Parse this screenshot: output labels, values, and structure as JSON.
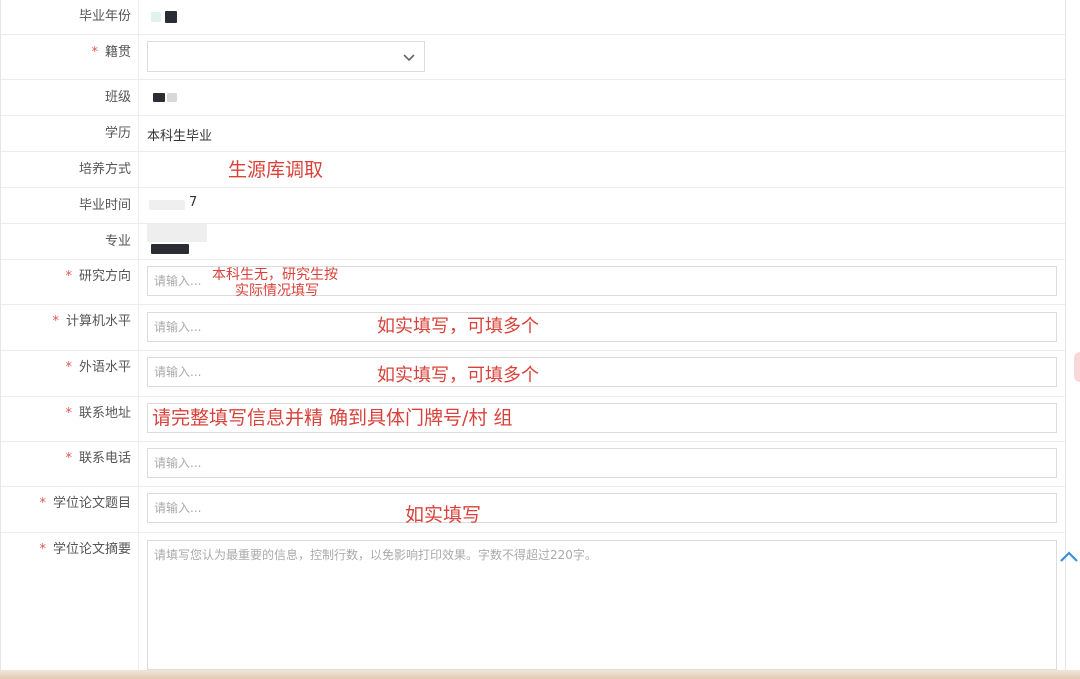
{
  "rows": [
    {
      "label": "毕业年份",
      "required": false,
      "kind": "value",
      "value": "",
      "redacted": true
    },
    {
      "label": "籍贯",
      "required": true,
      "kind": "select",
      "value": ""
    },
    {
      "label": "班级",
      "required": false,
      "kind": "value",
      "value": "",
      "redacted": true
    },
    {
      "label": "学历",
      "required": false,
      "kind": "value",
      "value": "本科生毕业"
    },
    {
      "label": "培养方式",
      "required": false,
      "kind": "value",
      "value": ""
    },
    {
      "label": "毕业时间",
      "required": false,
      "kind": "value",
      "value": "7",
      "redacted": true
    },
    {
      "label": "专业",
      "required": false,
      "kind": "value",
      "value": "",
      "redacted": true
    },
    {
      "label": "研究方向",
      "required": true,
      "kind": "input",
      "placeholder": "请输入..."
    },
    {
      "label": "计算机水平",
      "required": true,
      "kind": "input",
      "placeholder": "请输入..."
    },
    {
      "label": "外语水平",
      "required": true,
      "kind": "input",
      "placeholder": "请输入..."
    },
    {
      "label": "联系地址",
      "required": true,
      "kind": "input",
      "placeholder": ""
    },
    {
      "label": "联系电话",
      "required": true,
      "kind": "input",
      "placeholder": "请输入..."
    },
    {
      "label": "学位论文题目",
      "required": true,
      "kind": "input",
      "placeholder": "请输入..."
    },
    {
      "label": "学位论文摘要",
      "required": true,
      "kind": "textarea",
      "placeholder": "请填写您认为最重要的信息，控制行数，以免影响打印效果。字数不得超过220字。"
    }
  ],
  "required_mark": "*",
  "annotations": {
    "source_db": "生源库调取",
    "research_line1": "本科生无，研究生按",
    "research_line2": "实际情况填写",
    "computer": "如实填写，可填多个",
    "language": "如实填写，可填多个",
    "address": "请完整填写信息并精 确到具体门牌号/村 组",
    "thesis_title": "如实填写"
  },
  "colors": {
    "annotation": "#d9423a",
    "required": "#e05252",
    "border": "#dcdcdc"
  },
  "icons": {
    "select_chevron": "chevron-down-icon",
    "scroll_top": "chevron-up-icon"
  }
}
